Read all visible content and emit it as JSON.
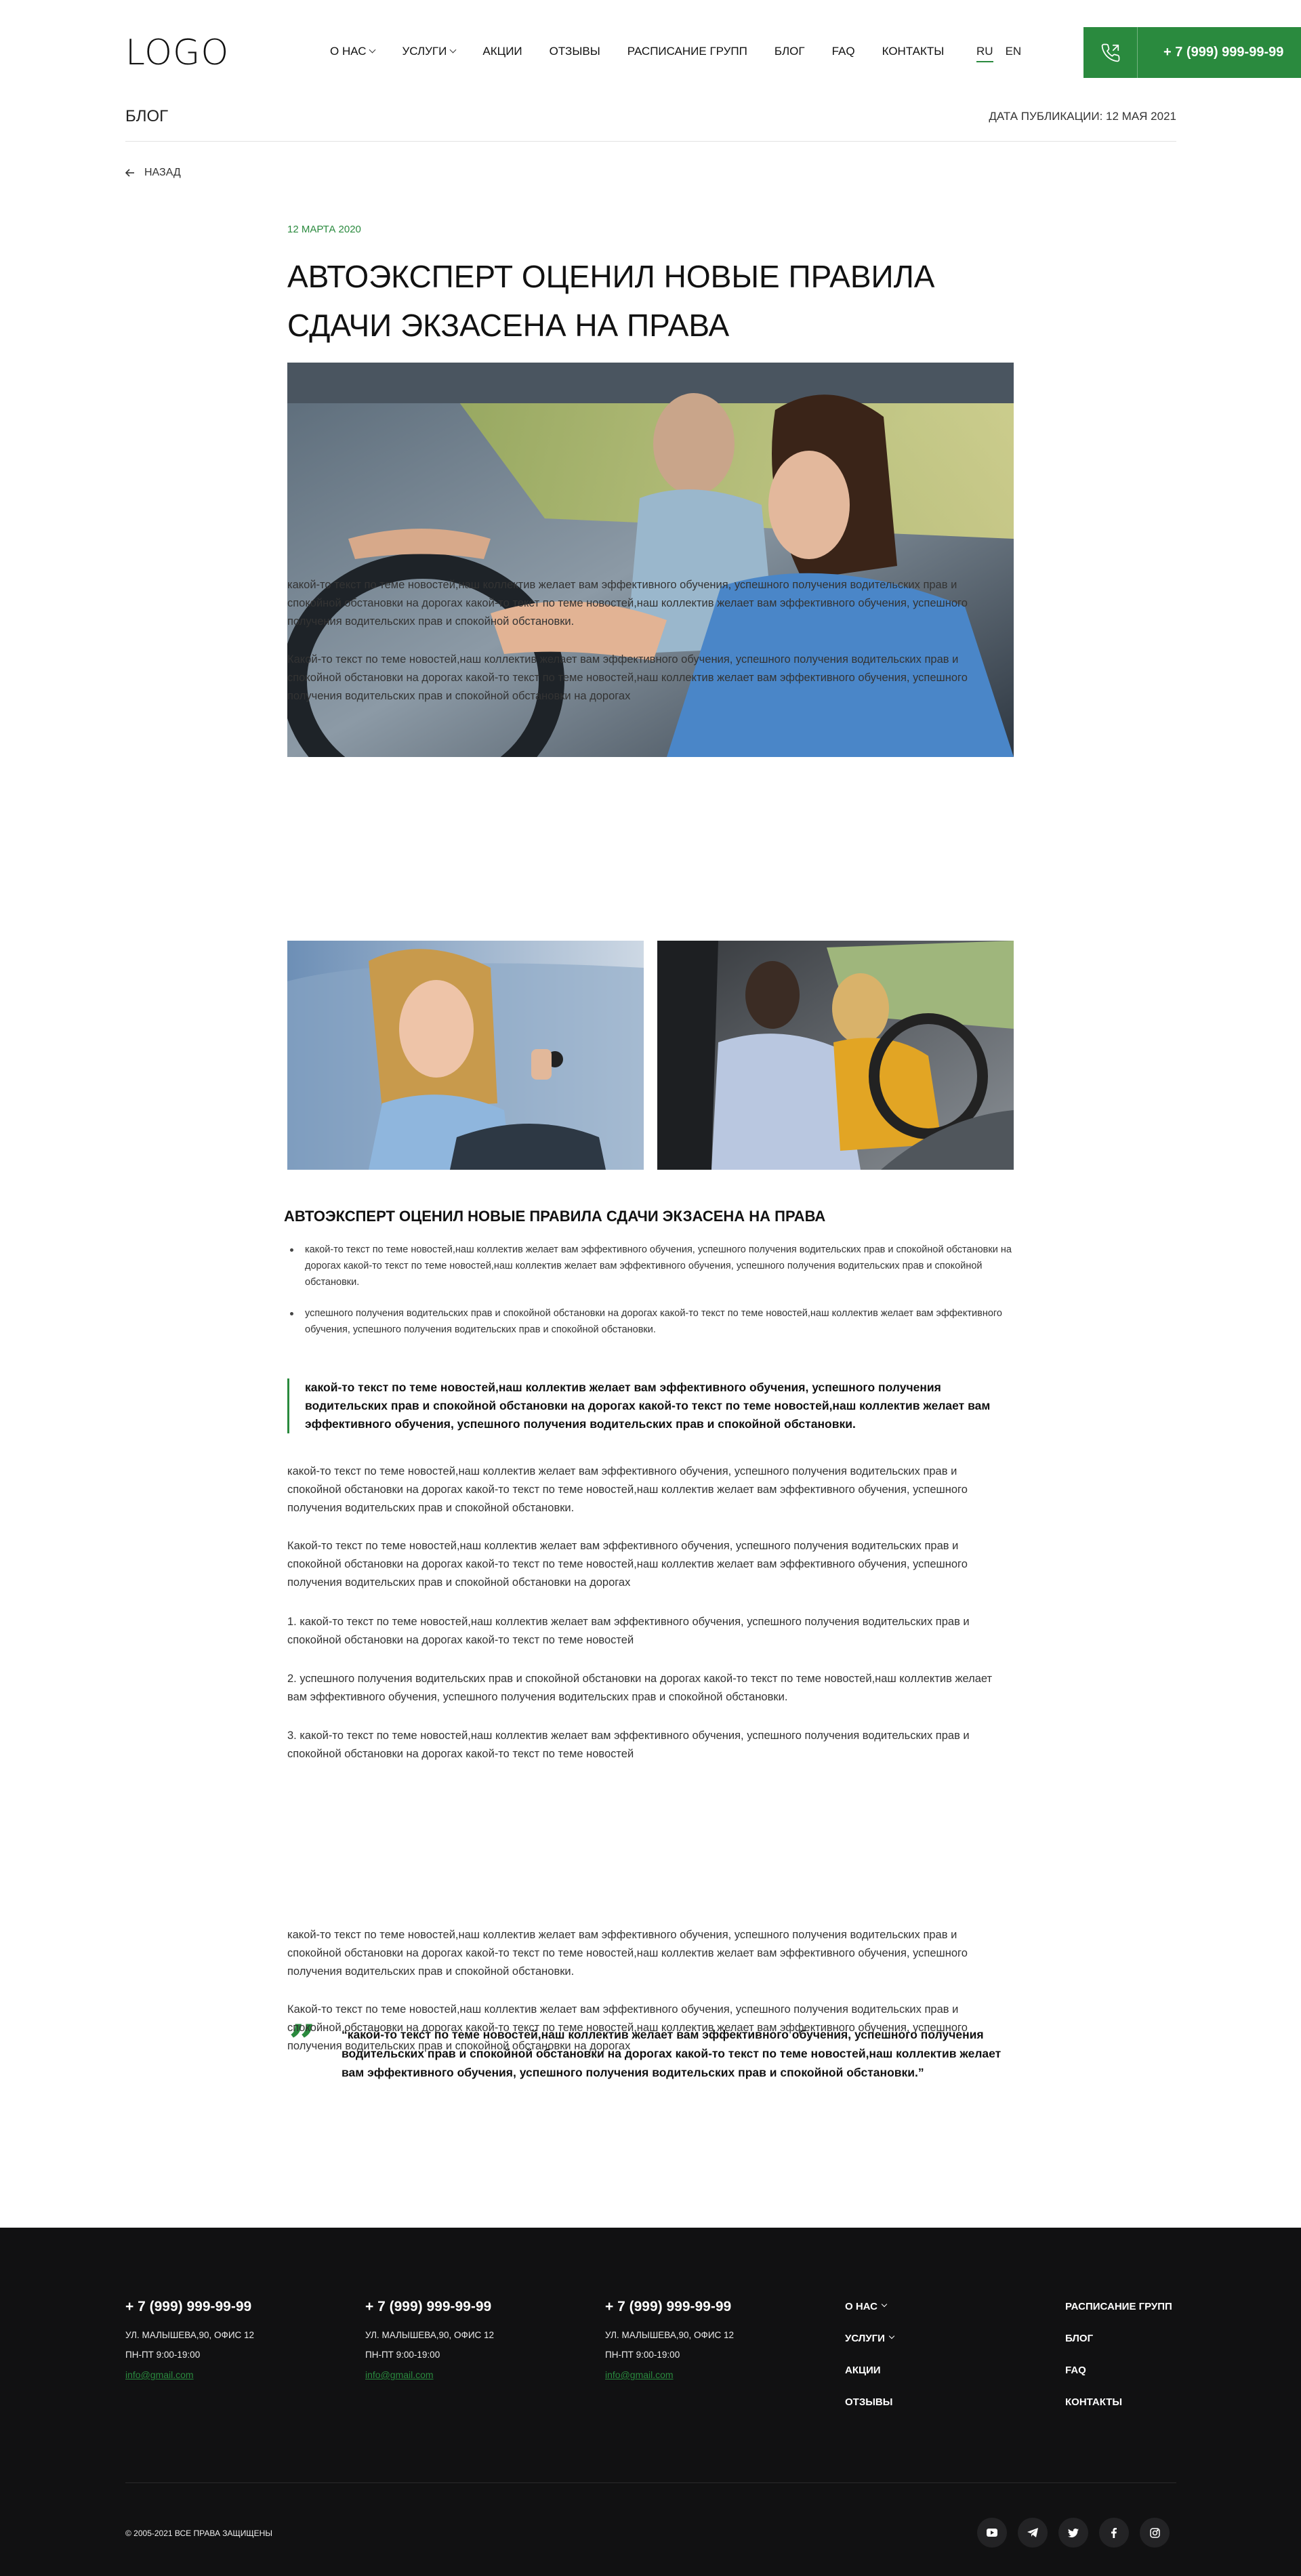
{
  "header": {
    "logo": "LOGO",
    "nav": [
      {
        "label": "О НАС",
        "dropdown": true
      },
      {
        "label": "УСЛУГИ",
        "dropdown": true
      },
      {
        "label": "АКЦИИ",
        "dropdown": false
      },
      {
        "label": "ОТЗЫВЫ",
        "dropdown": false
      },
      {
        "label": "РАСПИСАНИЕ ГРУПП",
        "dropdown": false
      },
      {
        "label": "БЛОГ",
        "dropdown": false
      },
      {
        "label": "FAQ",
        "dropdown": false
      },
      {
        "label": "КОНТАКТЫ",
        "dropdown": false
      }
    ],
    "lang": {
      "ru": "RU",
      "en": "EN",
      "active": "RU"
    },
    "phone": "+ 7 (999) 999-99-99",
    "accent_color": "#2a8a3e"
  },
  "subbar": {
    "title": "БЛОГ",
    "pubdate": "ДАТА ПУБЛИКАЦИИ: 12 МАЯ 2021"
  },
  "back_label": "НАЗАД",
  "article": {
    "date": "12 МАРТА 2020",
    "title": "АВТОЭКСПЕРТ ОЦЕНИЛ НОВЫЕ ПРАВИЛА СДАЧИ ЭКЗАСЕНА НА ПРАВА",
    "para1": "какой-то текст по теме новостей,наш коллектив желает вам эффективного обучения, успешного получения водительских прав и спокойной обстановки на дорогах какой-то текст по теме новостей,наш коллектив желает вам эффективного обучения, успешного получения водительских прав и спокойной обстановки.",
    "para2": "Какой-то текст по теме новостей,наш коллектив желает вам эффективного обучения, успешного получения водительских прав и спокойной обстановки на дорогах какой-то текст по теме новостей,наш коллектив желает вам эффективного обучения, успешного получения водительских прав и спокойной обстановки на дорогах",
    "subheading": "АВТОЭКСПЕРТ ОЦЕНИЛ НОВЫЕ ПРАВИЛА СДАЧИ ЭКЗАСЕНА НА ПРАВА",
    "bullets": [
      "какой-то текст по теме новостей,наш коллектив желает вам эффективного обучения, успешного получения водительских прав и спокойной обстановки на дорогах какой-то текст по теме новостей,наш коллектив желает вам эффективного обучения, успешного получения водительских прав и спокойной обстановки.",
      "успешного получения водительских прав и спокойной обстановки на дорогах какой-то текст по теме новостей,наш коллектив желает вам эффективного обучения, успешного получения водительских прав и спокойной обстановки."
    ],
    "callout": "какой-то текст по теме новостей,наш коллектив желает вам эффективного обучения, успешного получения водительских прав и спокойной обстановки на дорогах какой-то текст по теме новостей,наш коллектив желает вам эффективного обучения, успешного получения водительских прав и спокойной обстановки.",
    "para3": "какой-то текст по теме новостей,наш коллектив желает вам эффективного обучения, успешного получения водительских прав и спокойной обстановки на дорогах какой-то текст по теме новостей,наш коллектив желает вам эффективного обучения, успешного получения водительских прав и спокойной обстановки.",
    "para4": "Какой-то текст по теме новостей,наш коллектив желает вам эффективного обучения, успешного получения водительских прав и спокойной обстановки на дорогах какой-то текст по теме новостей,наш коллектив желает вам эффективного обучения, успешного получения водительских прав и спокойной обстановки на дорогах",
    "ordered": [
      "1.  какой-то текст по теме новостей,наш коллектив желает вам эффективного обучения, успешного получения водительских прав и спокойной обстановки на дорогах какой-то текст по теме новостей",
      "2.  успешного получения водительских прав и спокойной обстановки на дорогах какой-то текст по теме новостей,наш коллектив желает вам эффективного обучения, успешного получения водительских прав и спокойной обстановки.",
      "3.  какой-то текст по теме новостей,наш коллектив желает вам эффективного обучения, успешного получения водительских прав и спокойной обстановки на дорогах какой-то текст по теме новостей"
    ],
    "quote": "“какой-то текст по теме новостей,наш коллектив желает вам эффективного обучения, успешного получения водительских прав и спокойной обстановки на дорогах какой-то текст по теме новостей,наш коллектив желает вам эффективного обучения, успешного получения водительских прав и спокойной обстановки.”",
    "para5": "какой-то текст по теме новостей,наш коллектив желает вам эффективного обучения, успешного получения водительских прав и спокойной обстановки на дорогах какой-то текст по теме новостей,наш коллектив желает вам эффективного обучения, успешного получения водительских прав и спокойной обстановки.",
    "para6": "Какой-то текст по теме новостей,наш коллектив желает вам эффективного обучения, успешного получения водительских прав и спокойной обстановки на дорогах какой-то текст по теме новостей,наш коллектив желает вам эффективного обучения, успешного получения водительских прав и спокойной обстановки на дорогах"
  },
  "footer": {
    "contacts": [
      {
        "phone": "+ 7 (999) 999-99-99",
        "address": "УЛ. МАЛЫШЕВА,90, ОФИС 12",
        "hours": "ПН-ПТ 9:00-19:00",
        "email": "info@gmail.com"
      },
      {
        "phone": "+ 7 (999) 999-99-99",
        "address": "УЛ. МАЛЫШЕВА,90, ОФИС 12",
        "hours": "ПН-ПТ 9:00-19:00",
        "email": "info@gmail.com"
      },
      {
        "phone": "+ 7 (999) 999-99-99",
        "address": "УЛ. МАЛЫШЕВА,90, ОФИС 12",
        "hours": "ПН-ПТ 9:00-19:00",
        "email": "info@gmail.com"
      }
    ],
    "nav_col1": [
      {
        "label": "О НАС",
        "dropdown": true
      },
      {
        "label": "УСЛУГИ",
        "dropdown": true
      },
      {
        "label": "АКЦИИ",
        "dropdown": false
      },
      {
        "label": "ОТЗЫВЫ",
        "dropdown": false
      }
    ],
    "nav_col2": [
      "РАСПИСАНИЕ ГРУПП",
      "БЛОГ",
      "FAQ",
      "КОНТАКТЫ"
    ],
    "copyright": "© 2005-2021 ВСЕ ПРАВА ЗАЩИЩЕНЫ",
    "socials": [
      "youtube-icon",
      "telegram-icon",
      "twitter-icon",
      "facebook-icon",
      "instagram-icon"
    ]
  }
}
